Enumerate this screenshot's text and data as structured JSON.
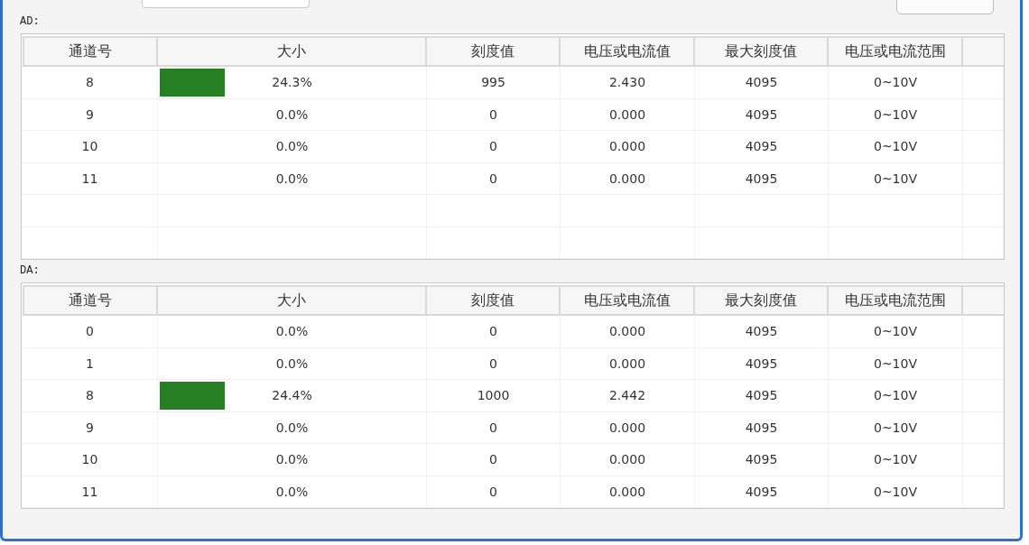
{
  "ad_section": {
    "label": "AD:",
    "columns": [
      "通道号",
      "大小",
      "刻度值",
      "电压或电流值",
      "最大刻度值",
      "电压或电流范围"
    ],
    "rows": [
      {
        "channel": "8",
        "percent": "24.3%",
        "level": 0.243,
        "scale": "995",
        "value": "2.430",
        "max_scale": "4095",
        "range": "0~10V"
      },
      {
        "channel": "9",
        "percent": "0.0%",
        "scale": "0",
        "value": "0.000",
        "max_scale": "4095",
        "range": "0~10V"
      },
      {
        "channel": "10",
        "percent": "0.0%",
        "scale": "0",
        "value": "0.000",
        "max_scale": "4095",
        "range": "0~10V"
      },
      {
        "channel": "11",
        "percent": "0.0%",
        "scale": "0",
        "value": "0.000",
        "max_scale": "4095",
        "range": "0~10V"
      }
    ]
  },
  "da_section": {
    "label": "DA:",
    "columns": [
      "通道号",
      "大小",
      "刻度值",
      "电压或电流值",
      "最大刻度值",
      "电压或电流范围"
    ],
    "rows": [
      {
        "channel": "0",
        "percent": "0.0%",
        "scale": "0",
        "value": "0.000",
        "max_scale": "4095",
        "range": "0~10V"
      },
      {
        "channel": "1",
        "percent": "0.0%",
        "scale": "0",
        "value": "0.000",
        "max_scale": "4095",
        "range": "0~10V"
      },
      {
        "channel": "8",
        "percent": "24.4%",
        "level": 0.244,
        "scale": "1000",
        "value": "2.442",
        "max_scale": "4095",
        "range": "0~10V"
      },
      {
        "channel": "9",
        "percent": "0.0%",
        "scale": "0",
        "value": "0.000",
        "max_scale": "4095",
        "range": "0~10V"
      },
      {
        "channel": "10",
        "percent": "0.0%",
        "scale": "0",
        "value": "0.000",
        "max_scale": "4095",
        "range": "0~10V"
      },
      {
        "channel": "11",
        "percent": "0.0%",
        "scale": "0",
        "value": "0.000",
        "max_scale": "4095",
        "range": "0~10V"
      }
    ]
  }
}
